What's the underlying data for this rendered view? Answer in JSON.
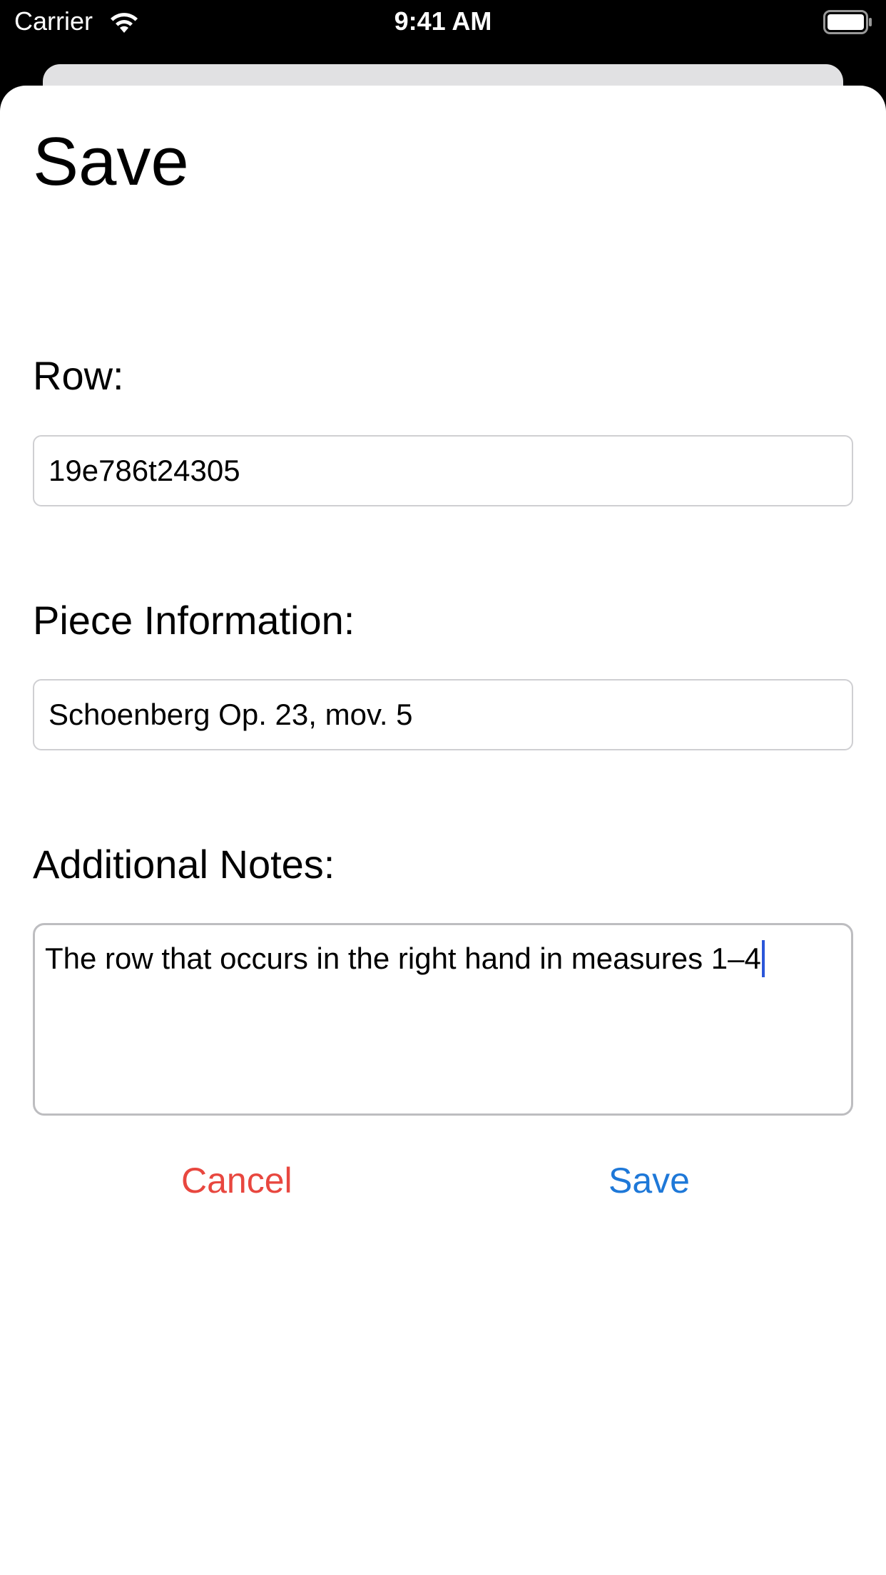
{
  "status_bar": {
    "carrier": "Carrier",
    "time": "9:41 AM",
    "wifi_icon": "wifi-icon",
    "battery_icon": "battery-icon"
  },
  "sheet": {
    "title": "Save",
    "row": {
      "label": "Row:",
      "value": "19e786t24305"
    },
    "piece_information": {
      "label": "Piece Information:",
      "value": "Schoenberg Op. 23, mov. 5"
    },
    "additional_notes": {
      "label": "Additional Notes:",
      "value": "The row that occurs in the right hand in measures 1–4"
    },
    "buttons": {
      "cancel_label": "Cancel",
      "save_label": "Save"
    }
  },
  "colors": {
    "cancel": "#e8473f",
    "save": "#1e78d8",
    "caret": "#2b56d9"
  }
}
